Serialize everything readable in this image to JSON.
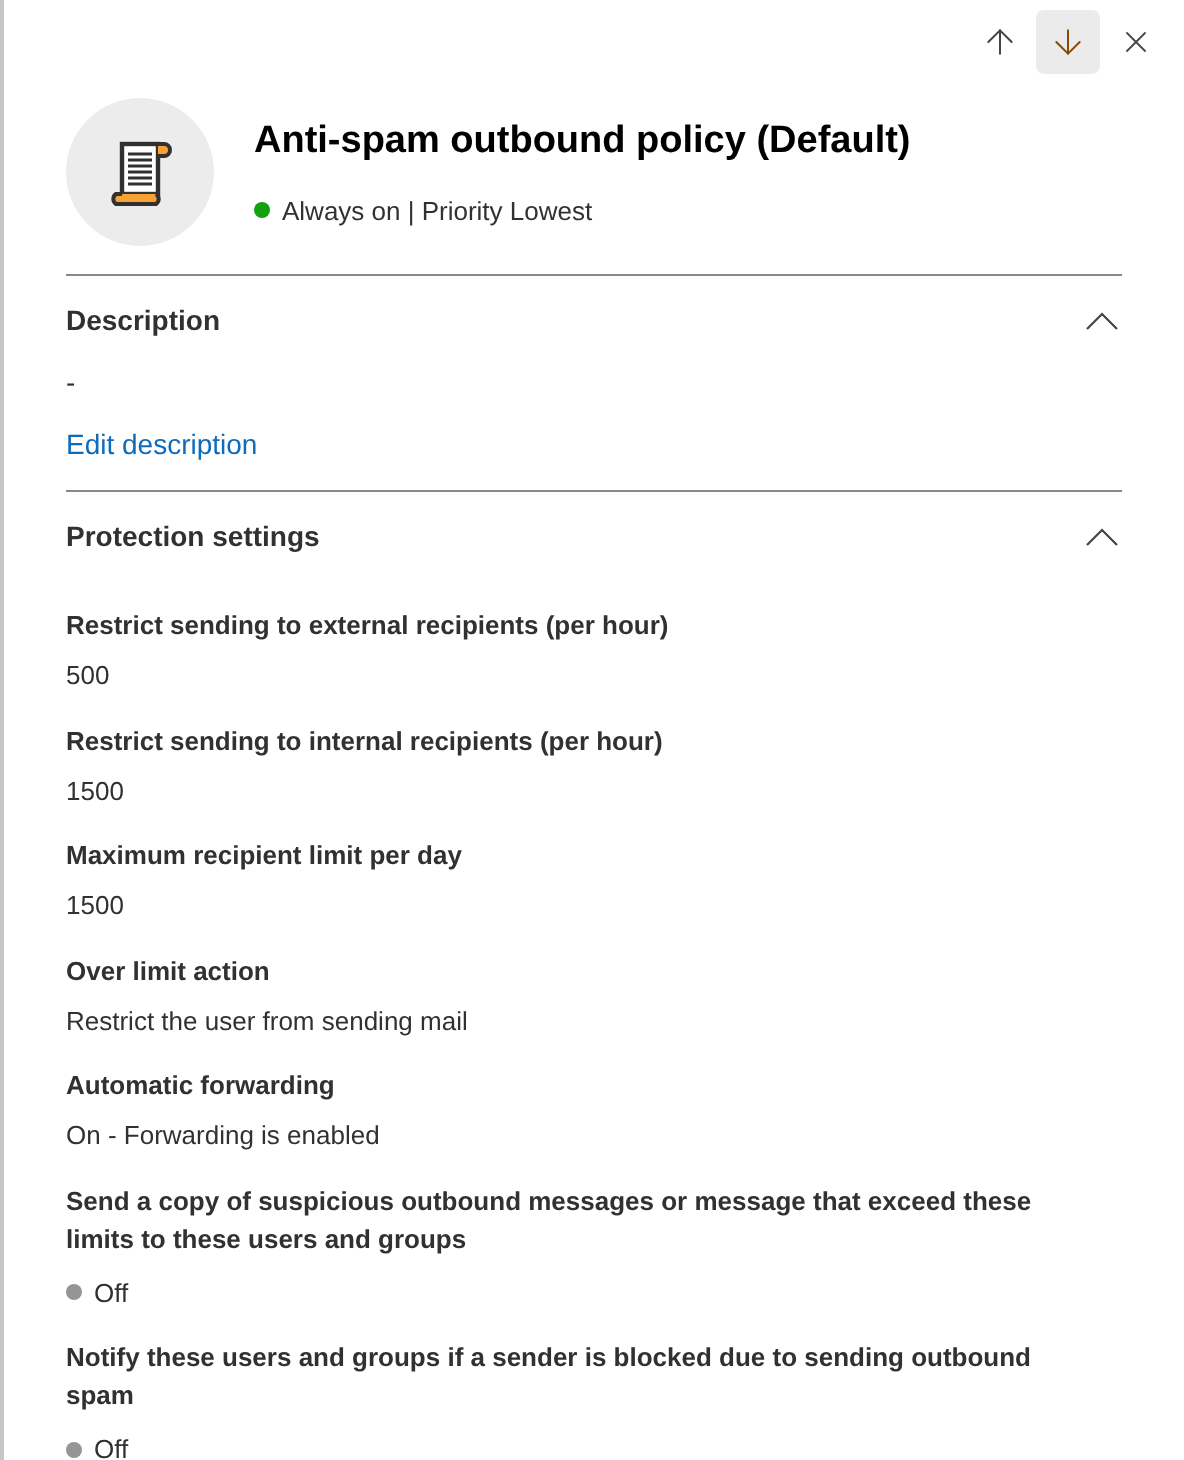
{
  "nav_buttons": [
    {
      "kind": "up",
      "highlighted": false
    },
    {
      "kind": "down",
      "highlighted": true
    }
  ],
  "header": {
    "title": "Anti-spam outbound policy (Default)",
    "status": {
      "text": "Always on | Priority Lowest",
      "color": "#13a10e"
    }
  },
  "description": {
    "title": "Description",
    "expanded": true,
    "value": "-",
    "link": "Edit description"
  },
  "protection": {
    "title": "Protection settings",
    "expanded": true,
    "settings": [
      {
        "label": "Restrict sending to external recipients (per hour)",
        "kind": "text",
        "value": "500"
      },
      {
        "label": "Restrict sending to internal recipients (per hour)",
        "kind": "text",
        "value": "1500"
      },
      {
        "label": "Maximum recipient limit per day",
        "kind": "text",
        "value": "1500"
      },
      {
        "label": "Over limit action",
        "kind": "text",
        "value": "Restrict the user from sending mail"
      },
      {
        "label": "Automatic forwarding",
        "kind": "text",
        "value": "On - Forwarding is enabled"
      },
      {
        "label": "Send a copy of suspicious outbound messages or message that exceed these limits to these users and groups",
        "kind": "status",
        "value": "Off",
        "color": "#979593"
      },
      {
        "label": "Notify these users and groups if a sender is blocked due to sending outbound spam",
        "kind": "status",
        "value": "Off",
        "color": "#979593"
      }
    ]
  }
}
